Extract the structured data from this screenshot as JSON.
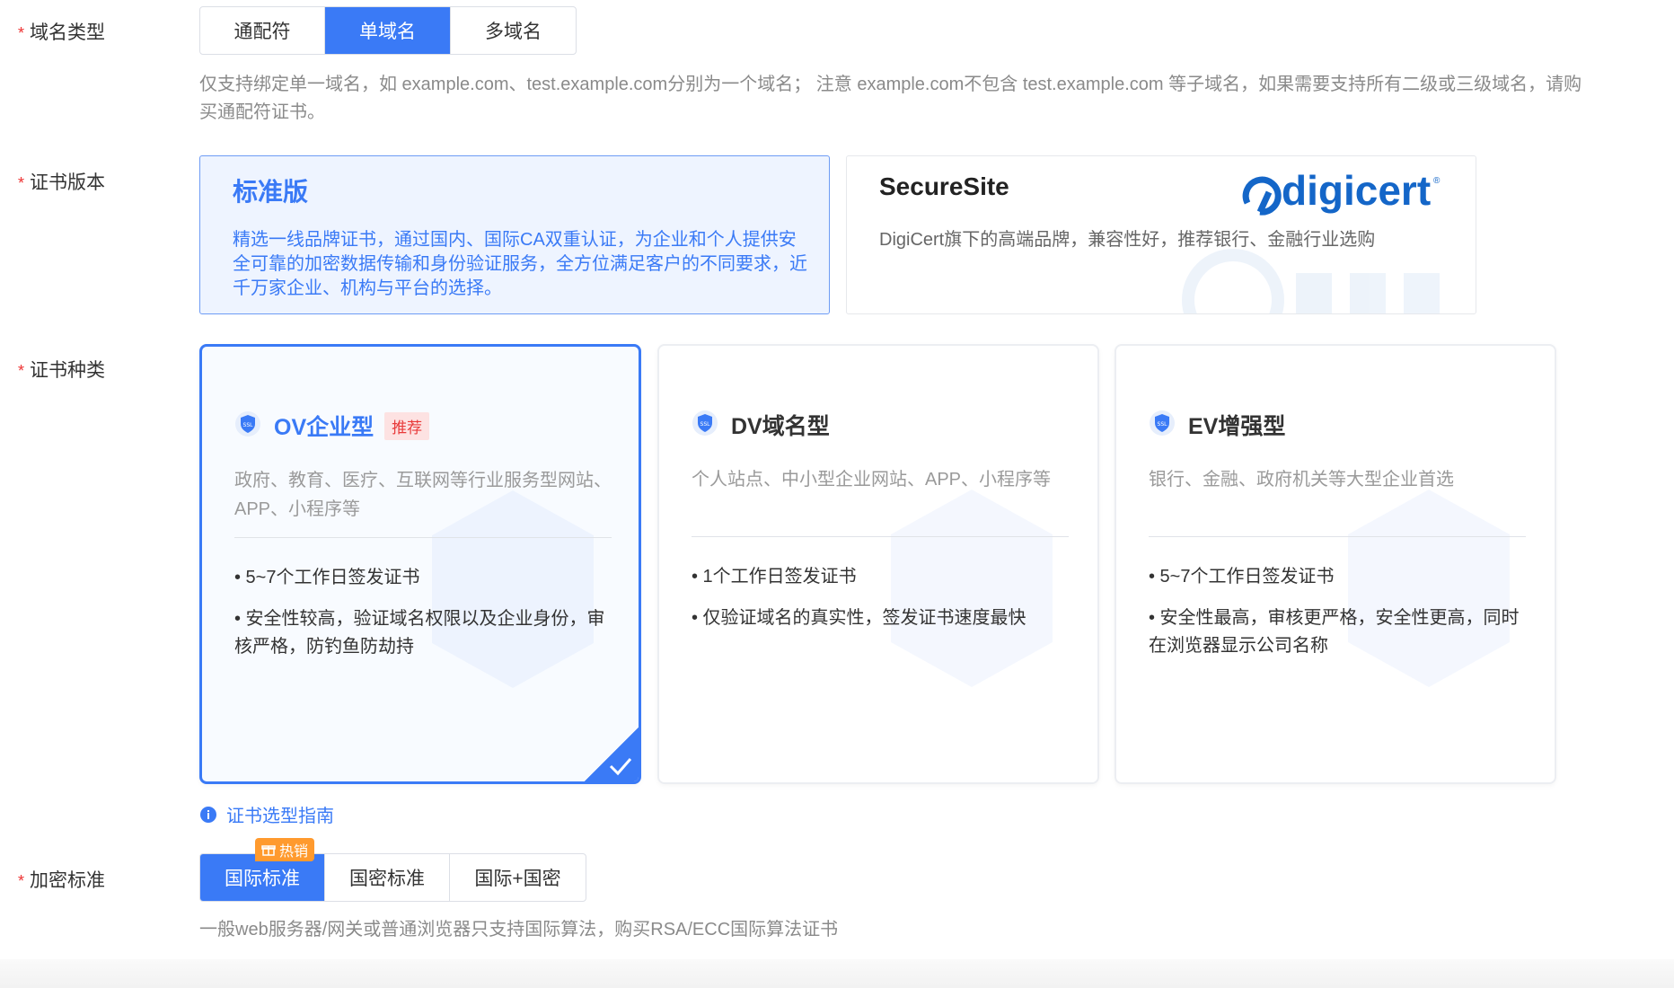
{
  "domain_type": {
    "label": "域名类型",
    "options": [
      "通配符",
      "单域名",
      "多域名"
    ],
    "selected": "单域名",
    "hint_line1": "仅支持绑定单一域名，如 example.com、test.example.com分别为一个域名； 注意 example.com不包含 test.example.com 等子域名，如果需要支持所有二级或三级域名，请购",
    "hint_line2": "买通配符证书。"
  },
  "cert_version": {
    "label": "证书版本",
    "standard": {
      "title": "标准版",
      "desc": "精选一线品牌证书，通过国内、国际CA双重认证，为企业和个人提供安全可靠的加密数据传输和身份验证服务，全方位满足客户的不同要求，近千万家企业、机构与平台的选择。"
    },
    "securesite": {
      "title": "SecureSite",
      "desc": "DigiCert旗下的高端品牌，兼容性好，推荐银行、金融行业选购",
      "logo_text": "digicert"
    }
  },
  "cert_type": {
    "label": "证书种类",
    "cards": [
      {
        "title": "OV企业型",
        "badge": "推荐",
        "sub": "政府、教育、医疗、互联网等行业服务型网站、APP、小程序等",
        "bullet1": "• 5~7个工作日签发证书",
        "bullet2": "• 安全性较高，验证域名权限以及企业身份，审核严格，防钓鱼防劫持",
        "icon": "ssl-shield-icon"
      },
      {
        "title": "DV域名型",
        "sub": "个人站点、中小型企业网站、APP、小程序等",
        "bullet1": "• 1个工作日签发证书",
        "bullet2": "• 仅验证域名的真实性，签发证书速度最快",
        "icon": "ssl-shield-icon"
      },
      {
        "title": "EV增强型",
        "sub": "银行、金融、政府机关等大型企业首选",
        "bullet1": "• 5~7个工作日签发证书",
        "bullet2": "• 安全性最高，审核更严格，安全性更高，同时在浏览器显示公司名称",
        "icon": "ssl-shield-icon"
      }
    ],
    "selected": "OV企业型",
    "guide": "证书选型指南"
  },
  "encryption": {
    "label": "加密标准",
    "options": [
      "国际标准",
      "国密标准",
      "国际+国密"
    ],
    "selected": "国际标准",
    "hot_badge": "热销",
    "hint": "一般web服务器/网关或普通浏览器只支持国际算法，购买RSA/ECC国际算法证书"
  },
  "colors": {
    "primary": "#3a7af6",
    "required": "#ee3333",
    "hot": "#ff9a2e",
    "recommend_bg": "#fde2e2",
    "recommend_text": "#e83a3a"
  }
}
